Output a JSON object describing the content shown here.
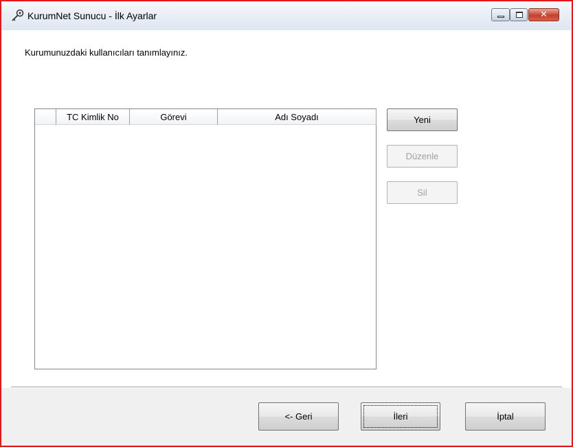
{
  "window": {
    "title": "KurumNet Sunucu - İlk Ayarlar",
    "app_icon": "key-wrench-icon",
    "controls": [
      "minimize-icon",
      "maximize-icon",
      "close-icon"
    ],
    "close_glyph": "✕"
  },
  "instruction": "Kurumunuzdaki kullanıcıları tanımlayınız.",
  "user_list": {
    "columns": [
      "",
      "TC Kimlik No",
      "Görevi",
      "Adı Soyadı"
    ],
    "rows": []
  },
  "side_buttons": {
    "new_label": "Yeni",
    "edit_label": "Düzenle",
    "delete_label": "Sil"
  },
  "nav_buttons": {
    "back_label": "<- Geri",
    "next_label": "İleri",
    "cancel_label": "İptal"
  }
}
